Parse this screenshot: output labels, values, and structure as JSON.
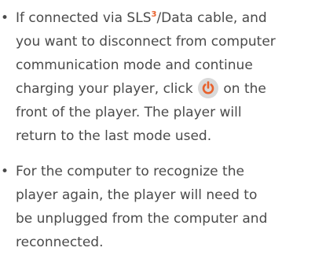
{
  "bullets": [
    {
      "marker": "•",
      "lines": [
        {
          "pre": "If connected via SLS",
          "sup": "3",
          "post": "/Data cable, and"
        },
        {
          "text": "you want to disconnect from computer"
        },
        {
          "text": "communication mode and continue"
        },
        {
          "pre": "charging your player, click",
          "icon": "power-icon",
          "post": "on the"
        },
        {
          "text": "front of the player. The player will"
        },
        {
          "text": "return to the last mode used."
        }
      ]
    },
    {
      "marker": "•",
      "lines": [
        {
          "text": "For the computer to recognize the"
        },
        {
          "text": "player again, the player will need to"
        },
        {
          "text": "be unplugged from the computer and"
        },
        {
          "text": "reconnected."
        }
      ]
    }
  ],
  "colors": {
    "text": "#4a4a4a",
    "superscript": "#e8612c",
    "icon_background": "#d9d9d9",
    "icon_glyph": "#e8612c"
  }
}
